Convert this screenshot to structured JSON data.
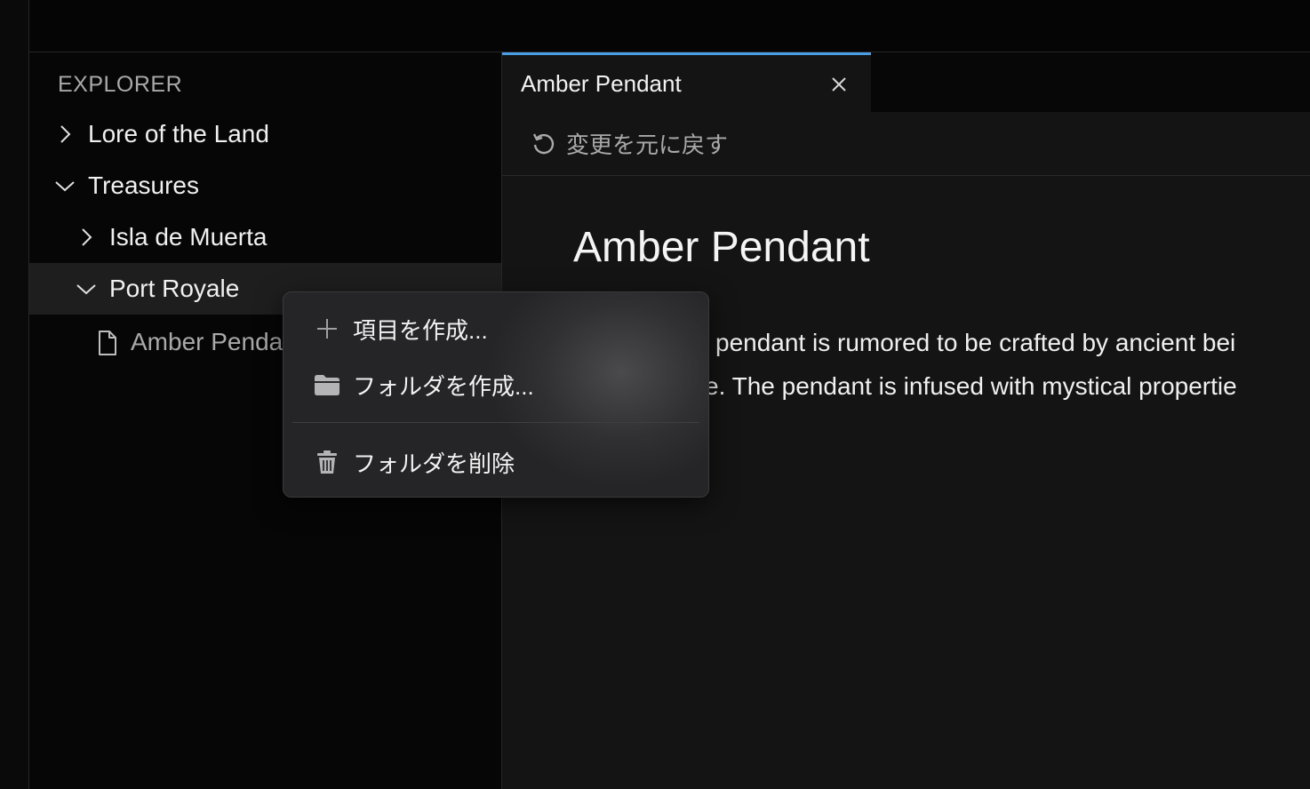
{
  "sidebar": {
    "title": "EXPLORER",
    "items": [
      {
        "label": "Lore of the Land",
        "expanded": false,
        "kind": "folder"
      },
      {
        "label": "Treasures",
        "expanded": true,
        "kind": "folder"
      },
      {
        "label": "Isla de Muerta",
        "expanded": false,
        "kind": "folder"
      },
      {
        "label": "Port Royale",
        "expanded": true,
        "kind": "folder",
        "selected": true
      },
      {
        "label": "Amber Pendant",
        "kind": "file",
        "icon": "file-icon"
      }
    ]
  },
  "editor": {
    "tab": {
      "label": "Amber Pendant",
      "close_icon": "close-icon"
    },
    "toolbar": {
      "revert_label": "変更を元に戻す",
      "revert_icon": "revert-icon"
    },
    "doc": {
      "title": "Amber Pendant",
      "body_line1": "pendant is rumored to be crafted by ancient bei",
      "body_line2": "e. The pendant is infused with mystical propertie"
    }
  },
  "context_menu": {
    "items": [
      {
        "label": "項目を作成...",
        "icon": "plus-icon"
      },
      {
        "label": "フォルダを作成...",
        "icon": "folder-icon"
      },
      {
        "label": "フォルダを削除",
        "icon": "trash-icon"
      }
    ]
  },
  "colors": {
    "accent": "#4a9ee8",
    "background": "#141414",
    "sidebar_bg": "#060606",
    "selected_row": "#1e1e1e",
    "menu_bg": "#252527"
  }
}
